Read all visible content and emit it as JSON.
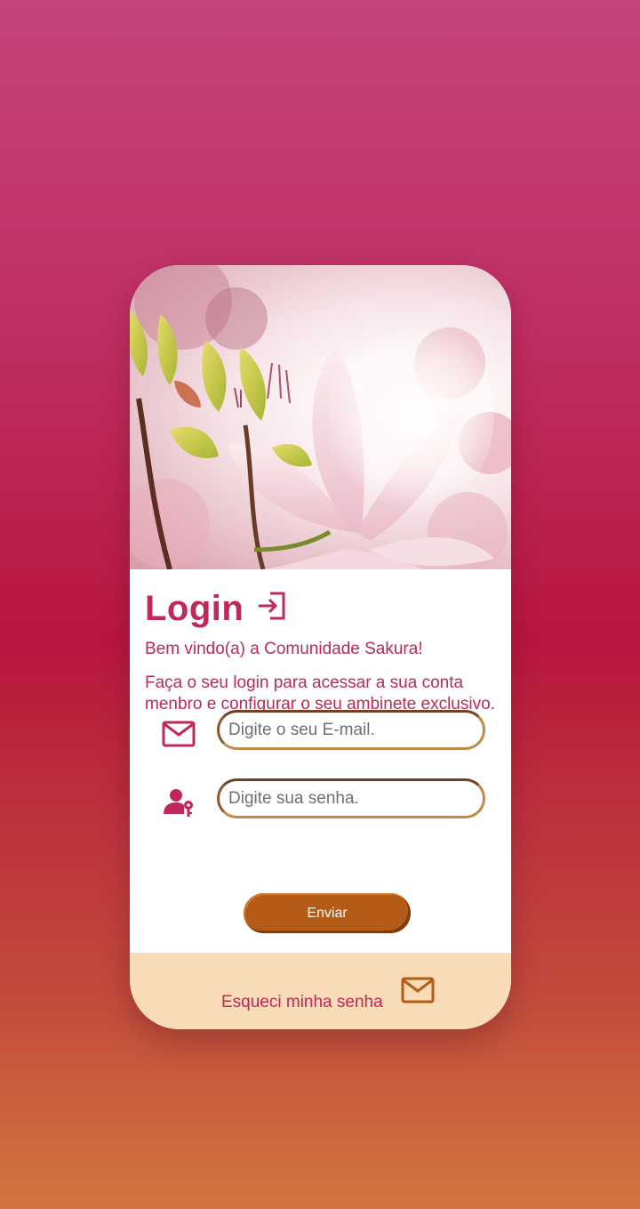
{
  "colors": {
    "accent": "#c0275a",
    "button": "#b45c17",
    "input_border": "#c18b4a",
    "footer_bg": "#f9dcb6"
  },
  "hero": {
    "image": "magnolia-blossom-photo"
  },
  "login": {
    "title": "Login",
    "title_icon": "login-arrow-icon",
    "welcome": "Bem vindo(a) a Comunidade Sakura!",
    "description": "Faça o seu login para acessar a sua conta menbro e configurar o seu ambinete exclusivo."
  },
  "form": {
    "email": {
      "icon": "mail-icon",
      "placeholder": "Digite o seu E-mail.",
      "value": ""
    },
    "password": {
      "icon": "user-key-icon",
      "placeholder": "Digite sua senha.",
      "value": ""
    },
    "submit_label": "Enviar"
  },
  "footer": {
    "forgot_label": "Esqueci minha senha",
    "forgot_icon": "mail-icon"
  }
}
